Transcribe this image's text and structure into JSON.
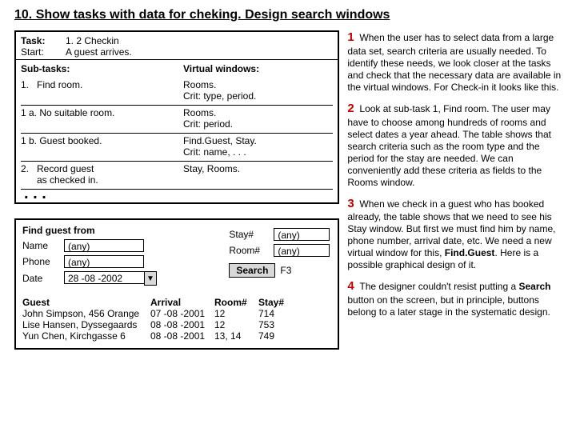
{
  "title": "10. Show tasks with data for cheking. Design search windows",
  "task_table": {
    "task_label": "Task:",
    "start_label": "Start:",
    "task_value": "1. 2 Checkin",
    "start_value": "A guest arrives.",
    "subtasks_hdr": "Sub-tasks:",
    "virtual_hdr": "Virtual windows:",
    "rows": [
      {
        "left": "1.   Find room.",
        "right": "Rooms.\nCrit: type, period."
      },
      {
        "left": "1 a. No suitable room.",
        "right": "Rooms.\nCrit: period."
      },
      {
        "left": "1 b. Guest booked.",
        "right": "Find.Guest, Stay.\nCrit: name, . . ."
      },
      {
        "left": "2.   Record guest\n      as checked in.",
        "right": "Stay, Rooms."
      }
    ],
    "dots": ". . ."
  },
  "find_guest": {
    "title": "Find guest from",
    "name_label": "Name",
    "phone_label": "Phone",
    "date_label": "Date",
    "name_value": "(any)",
    "phone_value": "(any)",
    "date_value": "28 -08 -2002",
    "stay_label": "Stay#",
    "room_label": "Room#",
    "stay_value": "(any)",
    "room_value": "(any)",
    "search_label": "Search",
    "search_key": "F3",
    "result_headers": {
      "guest": "Guest",
      "arrival": "Arrival",
      "room": "Room#",
      "stay": "Stay#"
    },
    "results": [
      {
        "guest": "John Simpson, 456 Orange",
        "arrival": "07 -08 -2001",
        "room": "12",
        "stay": "714"
      },
      {
        "guest": "Lise Hansen, Dyssegaards",
        "arrival": "08 -08 -2001",
        "room": "12",
        "stay": "753"
      },
      {
        "guest": "Yun Chen, Kirchgasse 6",
        "arrival": "08 -08 -2001",
        "room": "13, 14",
        "stay": "749"
      }
    ]
  },
  "paras": {
    "p1_num": "1",
    "p1": "When the user has to select data from a large data set, search criteria are usually needed. To identify these needs, we look closer at the tasks and check that the necessary data are available in the virtual windows. For Check-in it looks like this.",
    "p2_num": "2",
    "p2a": "Look at sub-task 1, Find room. The user may have to choose among hundreds of rooms and select dates a year ahead. The table shows that search criteria such as the room type and the period for the stay are needed. We can conveniently add these criteria as fields to the Rooms window.",
    "p3_num": "3",
    "p3a": "When we check in a guest who has booked already, the table shows that we need to see his Stay window. But first we must find him by name, phone number, arrival date, etc. We need a new virtual window for this, ",
    "p3b": "Find.Guest",
    "p3c": ". Here is a possible graphical design of it.",
    "p4_num": "4",
    "p4a": "The designer couldn't resist putting a ",
    "p4b": "Search",
    "p4c": " button on the screen, but in principle, buttons belong to a later stage in the systematic design."
  }
}
